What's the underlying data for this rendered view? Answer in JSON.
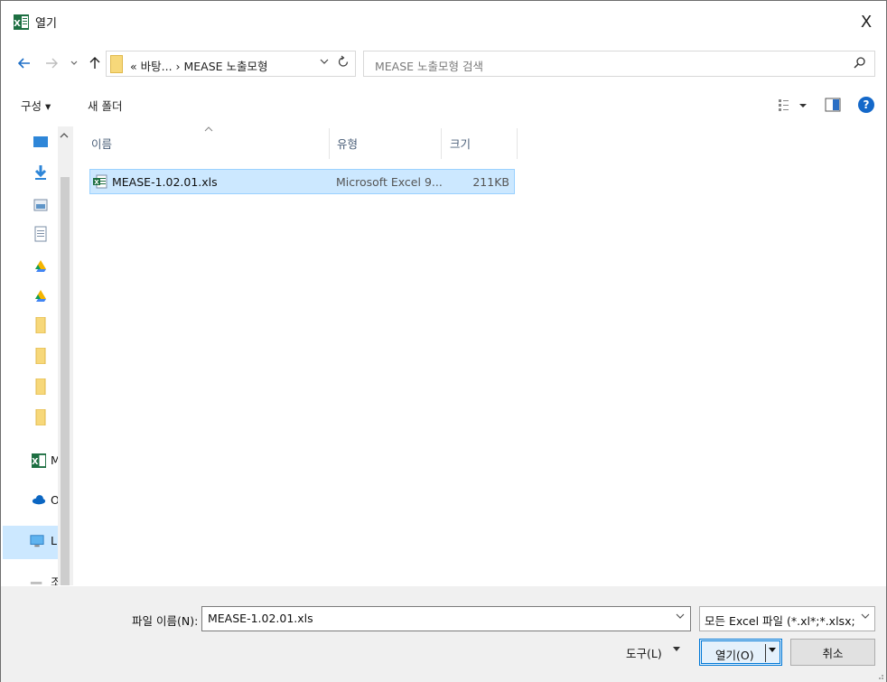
{
  "window": {
    "title": "열기",
    "close_glyph": "X"
  },
  "navigation": {
    "address_path": "«  바탕...  ›  MEASE 노출모형",
    "search_placeholder": "MEASE 노출모형 검색"
  },
  "toolbar": {
    "organize_label": "구성 ▾",
    "new_folder_label": "새 폴더",
    "help_glyph": "?"
  },
  "sidebar": {
    "items": [
      {
        "icon": "desktop-icon",
        "label": ""
      },
      {
        "icon": "download-icon",
        "label": ""
      },
      {
        "icon": "pictures-icon",
        "label": ""
      },
      {
        "icon": "documents-icon",
        "label": ""
      },
      {
        "icon": "google-drive-icon",
        "label": ""
      },
      {
        "icon": "google-drive-icon",
        "label": ""
      },
      {
        "icon": "folder-icon",
        "label": ""
      },
      {
        "icon": "folder-icon",
        "label": ""
      },
      {
        "icon": "folder-icon",
        "label": ""
      },
      {
        "icon": "folder-icon",
        "label": ""
      },
      {
        "icon": "excel-icon",
        "label": "M"
      },
      {
        "icon": "onedrive-icon",
        "label": "O"
      },
      {
        "icon": "this-pc-icon",
        "label": "L"
      },
      {
        "icon": "network-icon",
        "label": "조"
      }
    ]
  },
  "file_list": {
    "columns": [
      "이름",
      "유형",
      "크기"
    ],
    "rows": [
      {
        "name": "MEASE-1.02.01.xls",
        "type": "Microsoft Excel 9...",
        "size": "211KB"
      }
    ]
  },
  "bottom": {
    "filename_label": "파일 이름(N):",
    "filename_value": "MEASE-1.02.01.xls",
    "filter_value": "모든 Excel 파일 (*.xl*;*.xlsx;*.xl",
    "tools_label": "도구(L)",
    "open_label": "열기(O)",
    "cancel_label": "취소"
  },
  "colors": {
    "excel_green": "#1d6f42",
    "selection": "#cce8ff",
    "accent_blue": "#0078d7"
  }
}
